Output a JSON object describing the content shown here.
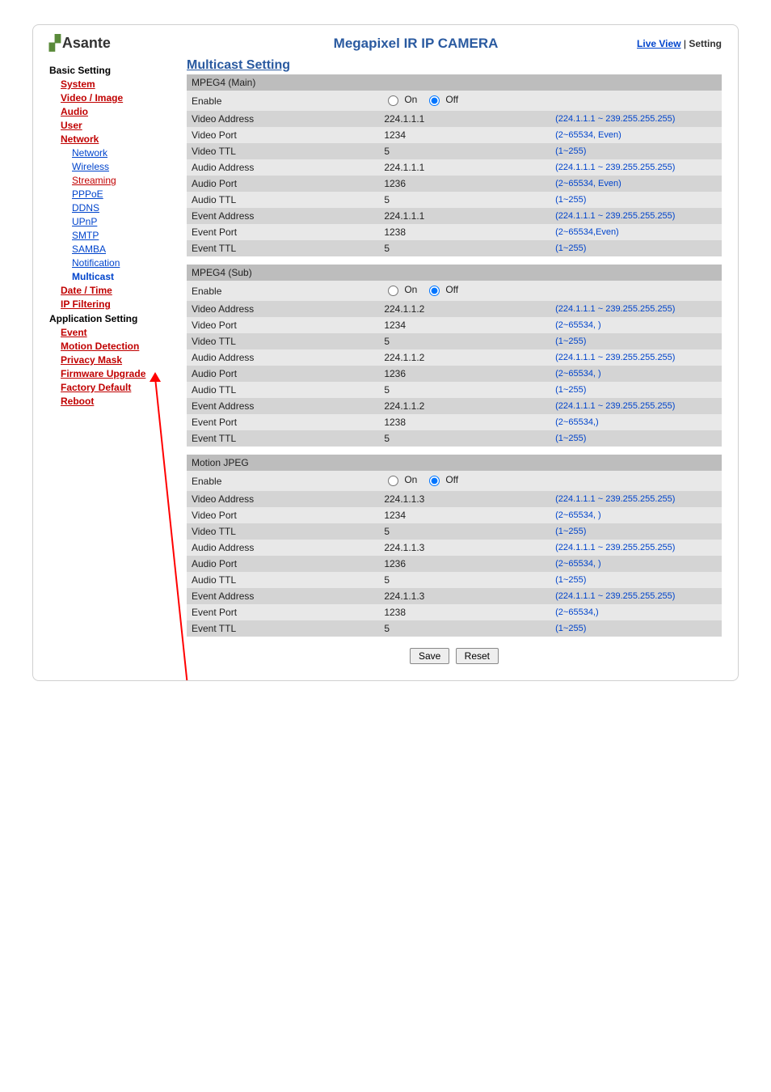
{
  "header": {
    "logo": "Asante",
    "title": "Megapixel IR IP CAMERA",
    "link_live": "Live View",
    "sep": " | ",
    "link_setting": "Setting"
  },
  "sidebar": {
    "basic": "Basic Setting",
    "system": "System",
    "video_image": "Video / Image",
    "audio": "Audio",
    "user": "User",
    "network": "Network",
    "net_items": {
      "network": "Network",
      "wireless": "Wireless",
      "streaming": "Streaming",
      "pppoe": "PPPoE",
      "ddns": "DDNS",
      "upnp": "UPnP",
      "smtp": "SMTP",
      "samba": "SAMBA",
      "notification": "Notification",
      "multicast": "Multicast"
    },
    "date_time": "Date / Time",
    "ip_filtering": "IP Filtering",
    "app": "Application Setting",
    "event": "Event",
    "motion": "Motion Detection",
    "privacy": "Privacy Mask",
    "firmware": "Firmware Upgrade",
    "factory": "Factory Default",
    "reboot": "Reboot"
  },
  "content": {
    "title": "Multicast Setting",
    "on": "On",
    "off": "Off",
    "labels": {
      "enable": "Enable",
      "video_address": "Video Address",
      "video_port": "Video Port",
      "video_ttl": "Video TTL",
      "audio_address": "Audio Address",
      "audio_port": "Audio Port",
      "audio_ttl": "Audio TTL",
      "event_address": "Event Address",
      "event_port": "Event Port",
      "event_ttl": "Event TTL"
    },
    "hints": {
      "addr": "(224.1.1.1 ~ 239.255.255.255)",
      "port_even": "(2~65534, Even)",
      "port_even2": "(2~65534,Even)",
      "port": "(2~65534, )",
      "port2": "(2~65534,)",
      "ttl": "(1~255)"
    },
    "groups": [
      {
        "name": "MPEG4 (Main)",
        "rows": [
          {
            "k": "enable",
            "v": "",
            "h": ""
          },
          {
            "k": "video_address",
            "v": "224.1.1.1",
            "h": "addr"
          },
          {
            "k": "video_port",
            "v": "1234",
            "h": "port_even"
          },
          {
            "k": "video_ttl",
            "v": "5",
            "h": "ttl"
          },
          {
            "k": "audio_address",
            "v": "224.1.1.1",
            "h": "addr"
          },
          {
            "k": "audio_port",
            "v": "1236",
            "h": "port_even"
          },
          {
            "k": "audio_ttl",
            "v": "5",
            "h": "ttl"
          },
          {
            "k": "event_address",
            "v": "224.1.1.1",
            "h": "addr"
          },
          {
            "k": "event_port",
            "v": "1238",
            "h": "port_even2"
          },
          {
            "k": "event_ttl",
            "v": "5",
            "h": "ttl"
          }
        ]
      },
      {
        "name": "MPEG4 (Sub)",
        "rows": [
          {
            "k": "enable",
            "v": "",
            "h": ""
          },
          {
            "k": "video_address",
            "v": "224.1.1.2",
            "h": "addr"
          },
          {
            "k": "video_port",
            "v": "1234",
            "h": "port"
          },
          {
            "k": "video_ttl",
            "v": "5",
            "h": "ttl"
          },
          {
            "k": "audio_address",
            "v": "224.1.1.2",
            "h": "addr"
          },
          {
            "k": "audio_port",
            "v": "1236",
            "h": "port"
          },
          {
            "k": "audio_ttl",
            "v": "5",
            "h": "ttl"
          },
          {
            "k": "event_address",
            "v": "224.1.1.2",
            "h": "addr"
          },
          {
            "k": "event_port",
            "v": "1238",
            "h": "port2"
          },
          {
            "k": "event_ttl",
            "v": "5",
            "h": "ttl"
          }
        ]
      },
      {
        "name": "Motion JPEG",
        "rows": [
          {
            "k": "enable",
            "v": "",
            "h": ""
          },
          {
            "k": "video_address",
            "v": "224.1.1.3",
            "h": "addr"
          },
          {
            "k": "video_port",
            "v": "1234",
            "h": "port"
          },
          {
            "k": "video_ttl",
            "v": "5",
            "h": "ttl"
          },
          {
            "k": "audio_address",
            "v": "224.1.1.3",
            "h": "addr"
          },
          {
            "k": "audio_port",
            "v": "1236",
            "h": "port"
          },
          {
            "k": "audio_ttl",
            "v": "5",
            "h": "ttl"
          },
          {
            "k": "event_address",
            "v": "224.1.1.3",
            "h": "addr"
          },
          {
            "k": "event_port",
            "v": "1238",
            "h": "port2"
          },
          {
            "k": "event_ttl",
            "v": "5",
            "h": "ttl"
          }
        ]
      }
    ],
    "save": "Save",
    "reset": "Reset"
  }
}
